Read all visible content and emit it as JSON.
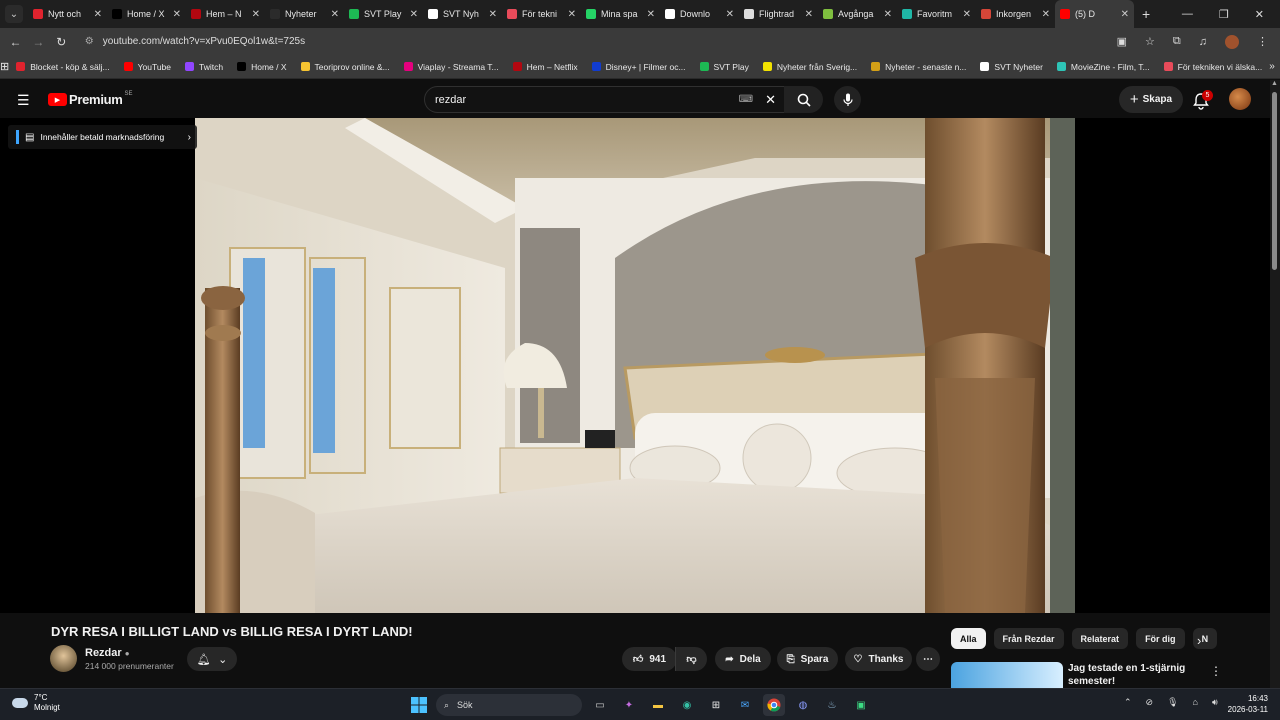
{
  "browser": {
    "tabs": [
      {
        "title": "Nytt och",
        "color": "#e0232e",
        "active": false
      },
      {
        "title": "Home / X",
        "color": "#000000",
        "active": false
      },
      {
        "title": "Hem – N",
        "color": "#b20710",
        "active": false
      },
      {
        "title": "Nyheter",
        "color": "#2b2b2b",
        "active": false
      },
      {
        "title": "SVT Play",
        "color": "#1db954",
        "active": false
      },
      {
        "title": "SVT Nyh",
        "color": "#ffffff",
        "active": false
      },
      {
        "title": "För tekni",
        "color": "#e84b5a",
        "active": false
      },
      {
        "title": "Mina spa",
        "color": "#25d366",
        "active": false
      },
      {
        "title": "Downlo",
        "color": "#ffffff",
        "active": false
      },
      {
        "title": "Flightrad",
        "color": "#dddddd",
        "active": false
      },
      {
        "title": "Avgånga",
        "color": "#7fbf3f",
        "active": false
      },
      {
        "title": "Favoritm",
        "color": "#1fb7a6",
        "active": false
      },
      {
        "title": "Inkorgen",
        "color": "#d44638",
        "active": false
      },
      {
        "title": "(5) D",
        "color": "#ff0000",
        "active": true
      }
    ],
    "url": "youtube.com/watch?v=xPvu0EQol1w&t=725s",
    "bookmarks": [
      {
        "label": "Blocket - köp & sälj...",
        "color": "#e0232e"
      },
      {
        "label": "YouTube",
        "color": "#ff0000"
      },
      {
        "label": "Twitch",
        "color": "#9146ff"
      },
      {
        "label": "Home / X",
        "color": "#000000"
      },
      {
        "label": "Teoriprov online &...",
        "color": "#f6c431"
      },
      {
        "label": "Viaplay - Streama T...",
        "color": "#e5007e"
      },
      {
        "label": "Hem – Netflix",
        "color": "#b20710"
      },
      {
        "label": "Disney+ | Filmer oc...",
        "color": "#113ccf"
      },
      {
        "label": "SVT Play",
        "color": "#1db954"
      },
      {
        "label": "Nyheter från Sverig...",
        "color": "#f2e200"
      },
      {
        "label": "Nyheter - senaste n...",
        "color": "#d4a017"
      },
      {
        "label": "SVT Nyheter",
        "color": "#ffffff"
      },
      {
        "label": "MovieZine - Film, T...",
        "color": "#2ec4b6"
      },
      {
        "label": "För tekniken vi älska...",
        "color": "#e84b5a"
      }
    ]
  },
  "header": {
    "logo_text": "Premium",
    "logo_region": "SE",
    "search_value": "rezdar",
    "create_label": "Skapa",
    "notif_count": "5"
  },
  "player": {
    "promo_label": "Innehåller betald marknadsföring"
  },
  "video": {
    "title": "DYR RESA I BILLIGT LAND vs BILLIG RESA I DYRT LAND!",
    "channel": "Rezdar",
    "subscribers": "214 000 prenumeranter",
    "likes": "941",
    "share_label": "Dela",
    "save_label": "Spara",
    "thanks_label": "Thanks"
  },
  "sidebar": {
    "chips": [
      "Alla",
      "Från Rezdar",
      "Relaterat",
      "För dig",
      "N"
    ],
    "rec_title": "Jag testade en 1-stjärnig semester!"
  },
  "taskbar": {
    "temp": "7°C",
    "weather": "Molnigt",
    "search_label": "Sök",
    "time": "16:43",
    "date": "2026-03-11"
  }
}
